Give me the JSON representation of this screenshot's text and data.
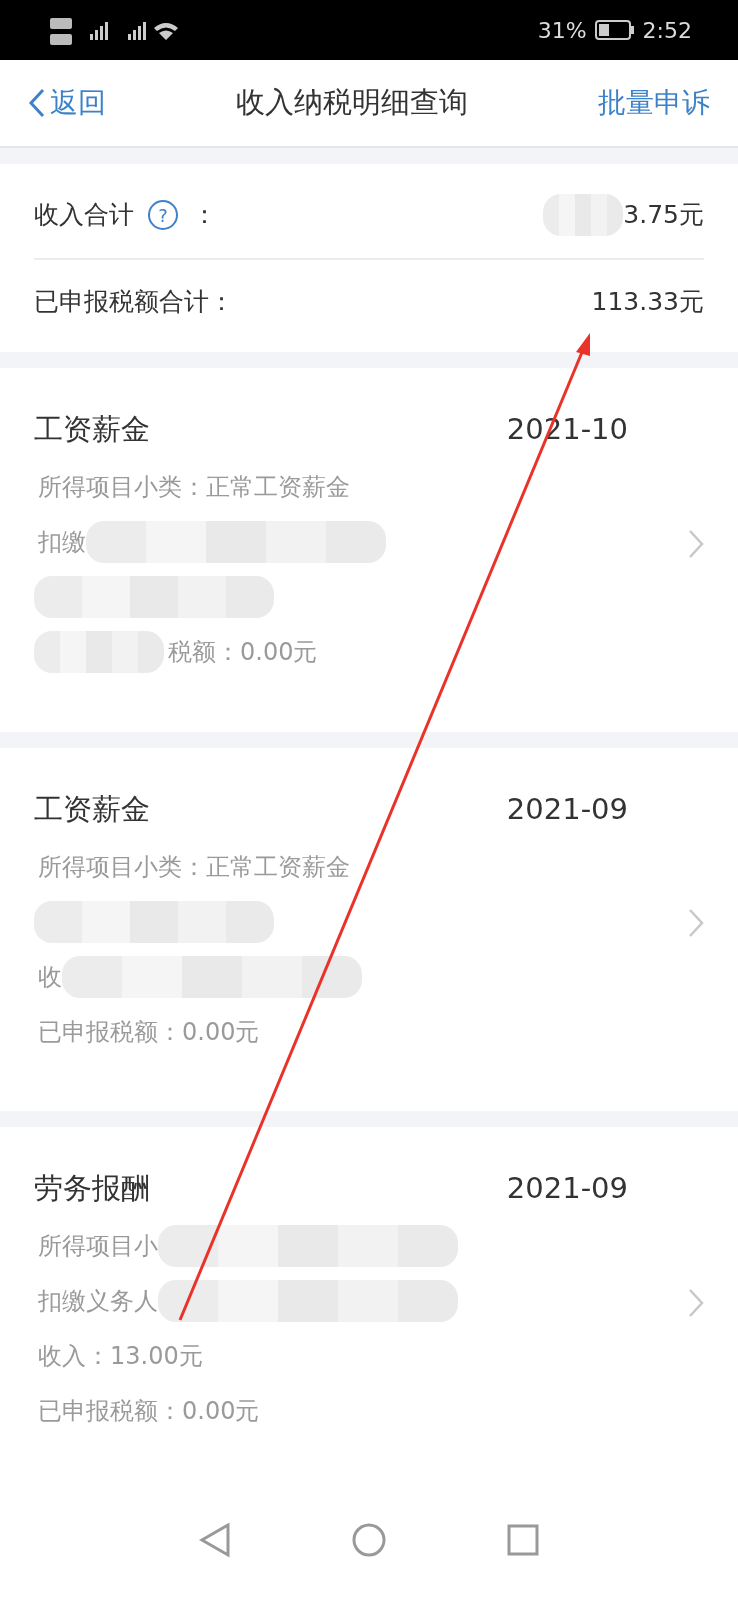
{
  "status_bar": {
    "battery_percent": "31%",
    "time": "2:52"
  },
  "nav": {
    "back": "返回",
    "title": "收入纳税明细查询",
    "action": "批量申诉"
  },
  "summary": [
    {
      "label": "收入合计",
      "help": "?",
      "colon": "：",
      "value": "3.75元",
      "masked": true
    },
    {
      "label": "已申报税额合计：",
      "value": "113.33元"
    }
  ],
  "records": [
    {
      "type": "工资薪金",
      "period": "2021-10",
      "lines": [
        {
          "kind": "text",
          "text": "所得项目小类：正常工资薪金"
        },
        {
          "kind": "text",
          "text": "扣缴",
          "masked_after": true
        },
        {
          "kind": "mosaic"
        },
        {
          "kind": "text",
          "text": "税额：0.00元",
          "masked_before": true
        }
      ]
    },
    {
      "type": "工资薪金",
      "period": "2021-09",
      "lines": [
        {
          "kind": "text",
          "text": "所得项目小类：正常工资薪金"
        },
        {
          "kind": "mosaic"
        },
        {
          "kind": "text",
          "text": "收",
          "masked_after": true
        },
        {
          "kind": "text",
          "text": "已申报税额：0.00元"
        }
      ]
    },
    {
      "type": "劳务报酬",
      "period": "2021-09",
      "lines": [
        {
          "kind": "text",
          "text": "所得项目小",
          "masked_after": true
        },
        {
          "kind": "text",
          "text": "扣缴义务人",
          "masked_after": true
        },
        {
          "kind": "text",
          "text": "收入：13.00元"
        },
        {
          "kind": "text",
          "text": "已申报税额：0.00元"
        }
      ]
    }
  ]
}
